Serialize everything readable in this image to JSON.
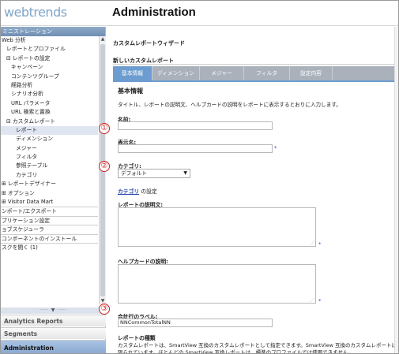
{
  "header": {
    "logo": "webtrends",
    "title": "Administration"
  },
  "sidebar": {
    "head": "ミニストレーション",
    "tree": [
      {
        "label": "Web 分析",
        "indent": 0
      },
      {
        "label": "レポートとプロファイル",
        "indent": 1
      },
      {
        "label": "⊟ レポートの設定",
        "indent": 1
      },
      {
        "label": "キャンペーン",
        "indent": 2
      },
      {
        "label": "コンテンツグループ",
        "indent": 2
      },
      {
        "label": "経路分析",
        "indent": 2
      },
      {
        "label": "シナリオ分析",
        "indent": 2
      },
      {
        "label": "URL パラメータ",
        "indent": 2
      },
      {
        "label": "URL 検索と置換",
        "indent": 2
      },
      {
        "label": "⊟ カスタムレポート",
        "indent": 1
      },
      {
        "label": "レポート",
        "indent": 3,
        "selected": true
      },
      {
        "label": "ディメンション",
        "indent": 3
      },
      {
        "label": "メジャー",
        "indent": 3
      },
      {
        "label": "フィルタ",
        "indent": 3
      },
      {
        "label": "参照テーブル",
        "indent": 3
      },
      {
        "label": "カテゴリ",
        "indent": 3
      },
      {
        "label": "⊞ レポートデザイナー",
        "indent": 0
      },
      {
        "label": "⊞ オプション",
        "indent": 0
      },
      {
        "label": "⊞ Visitor Data Mart",
        "indent": 0
      },
      {
        "label": "ンポート/エクスポート",
        "indent": 0,
        "sep": true
      },
      {
        "label": "プリケーション設定",
        "indent": 0,
        "sep": true
      },
      {
        "label": "ョブスケジューラ",
        "indent": 0,
        "sep": true
      },
      {
        "label": "コンポーネントのインストール",
        "indent": 0,
        "sep": true
      },
      {
        "label": "スクを開く (1)",
        "indent": 0,
        "sep": true
      }
    ],
    "splitter": "···· ▼ ····",
    "nav": [
      "Analytics Reports",
      "Segments",
      "Administration"
    ]
  },
  "main": {
    "wizard_title": "カスタムレポートウィザード",
    "subheader": "新しいカスタムレポート",
    "tabs": [
      "基本情報",
      "ディメンション",
      "メジャー",
      "フィルタ",
      "設定内容"
    ],
    "section_title": "基本情報",
    "description": "タイトル、レポートの説明文、ヘルプカードの説明をレポートに表示するとおりに入力します。",
    "name_label": "名前:",
    "display_name_label": "表示名:",
    "category_label": "カテゴリ:",
    "category_value": "デフォルト",
    "category_link": "カテゴリ",
    "category_link_suffix": " の設定",
    "report_desc_label": "レポートの説明文:",
    "helpcard_label": "ヘルプカードの説明:",
    "total_row_label": "合計行のラベル:",
    "total_row_value": "NNCommonTotalNN",
    "report_type_label": "レポートの種類",
    "report_type_text1": "カスタムレポートは、SmartView 互換のカスタムレポートとして指定できます。SmartView 互換のカスタムレポートは、使用可",
    "report_type_text2": "限られています。ほとんどの SmartView 互換レポートは、標準のプロファイルでは使用できません。",
    "required": "*"
  },
  "markers": [
    "①",
    "②",
    "③"
  ],
  "colors": {
    "tab_active": "#6d9dd0",
    "nav_active": "#87a7cf",
    "marker": "#cc2222"
  }
}
